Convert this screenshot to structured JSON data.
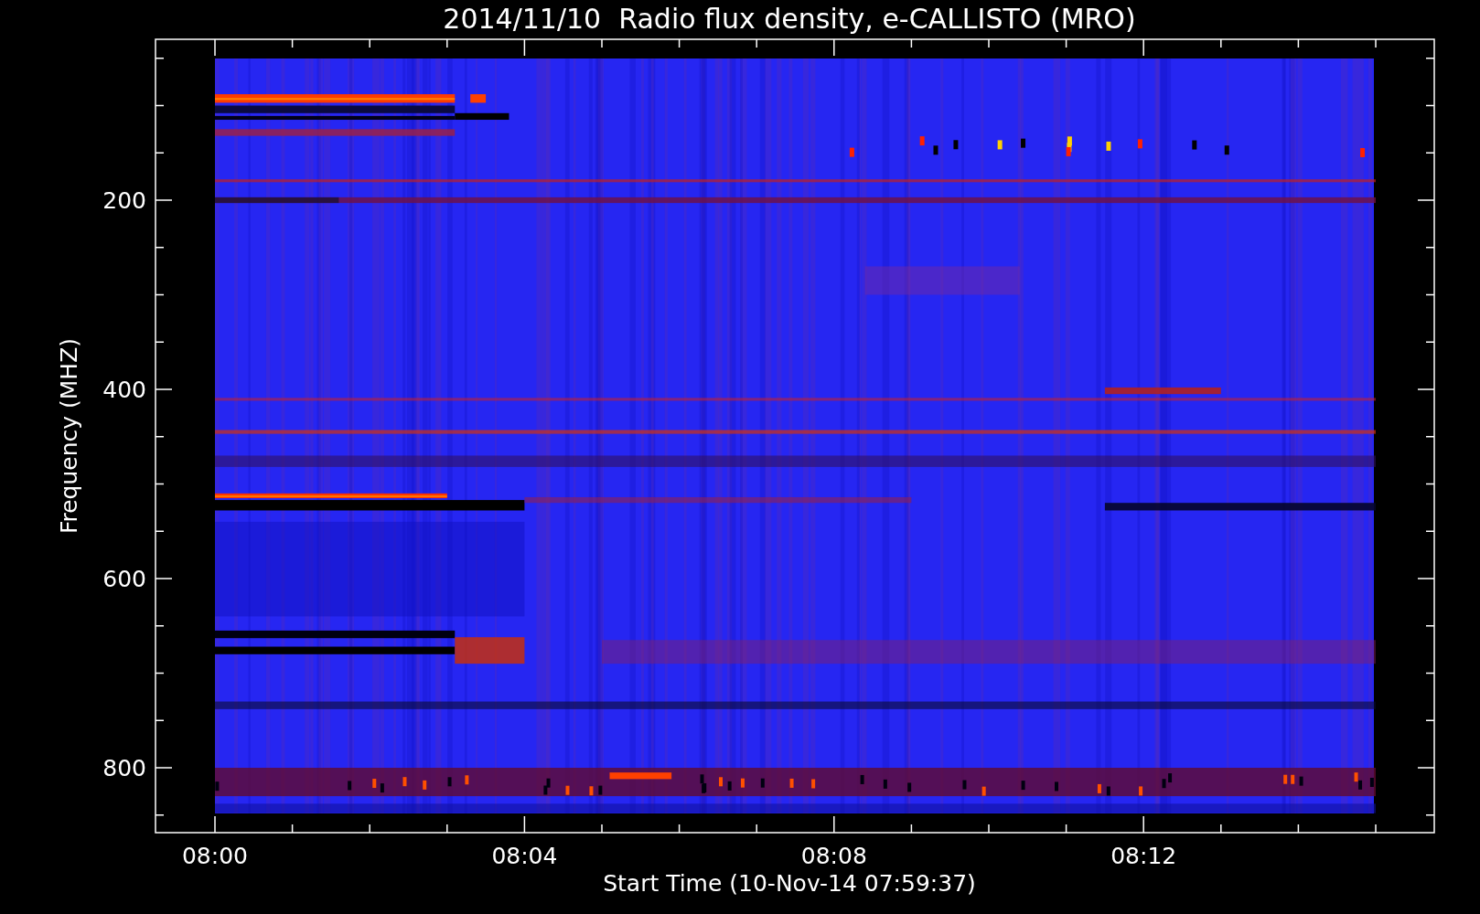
{
  "plot": {
    "title": "2014/11/10  Radio flux density, e-CALLISTO (MRO)",
    "ylabel": "Frequency (MHZ)",
    "xlabel": "Start Time (10-Nov-14 07:59:37)",
    "yticks": [
      "200",
      "400",
      "600",
      "800"
    ],
    "xticks": [
      "08:00",
      "08:04",
      "08:08",
      "08:12"
    ]
  }
}
